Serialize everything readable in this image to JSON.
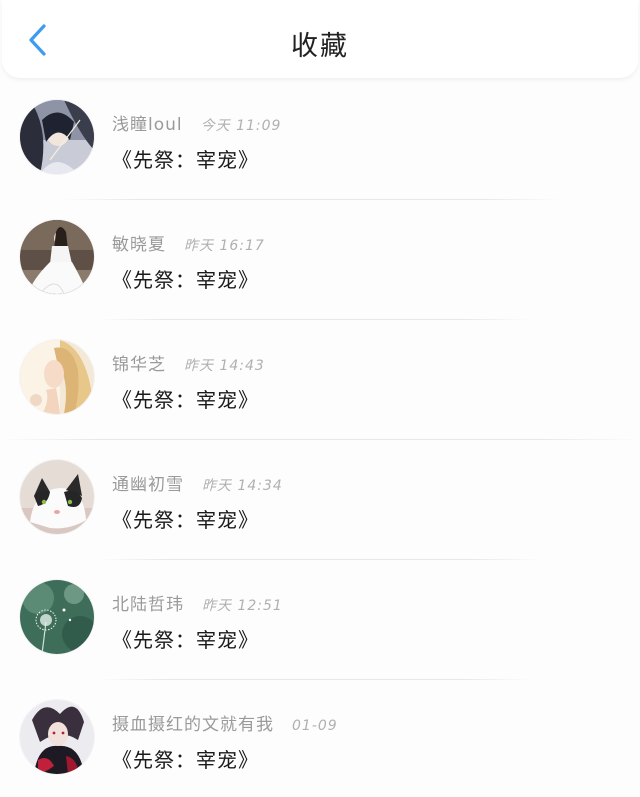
{
  "header": {
    "title": "收藏",
    "back_icon": "chevron-left-icon",
    "accent_color": "#3d9bf0"
  },
  "items": [
    {
      "user": "浅瞳loul",
      "time": "今天 11:09",
      "title": "《先祭：宰宠》",
      "avatar": "anime-girl-avatar"
    },
    {
      "user": "敏晓夏",
      "time": "昨天 16:17",
      "title": "《先祭：宰宠》",
      "avatar": "bride-white-dress-avatar"
    },
    {
      "user": "锦华芝",
      "time": "昨天 14:43",
      "title": "《先祭：宰宠》",
      "avatar": "blonde-girl-avatar"
    },
    {
      "user": "通幽初雪",
      "time": "昨天 14:34",
      "title": "《先祭：宰宠》",
      "avatar": "cat-avatar"
    },
    {
      "user": "北陆哲玮",
      "time": "昨天 12:51",
      "title": "《先祭：宰宠》",
      "avatar": "dandelion-avatar"
    },
    {
      "user": "摄血摄红的文就有我",
      "time": "01-09",
      "title": "《先祭：宰宠》",
      "avatar": "anime-character-avatar"
    }
  ]
}
